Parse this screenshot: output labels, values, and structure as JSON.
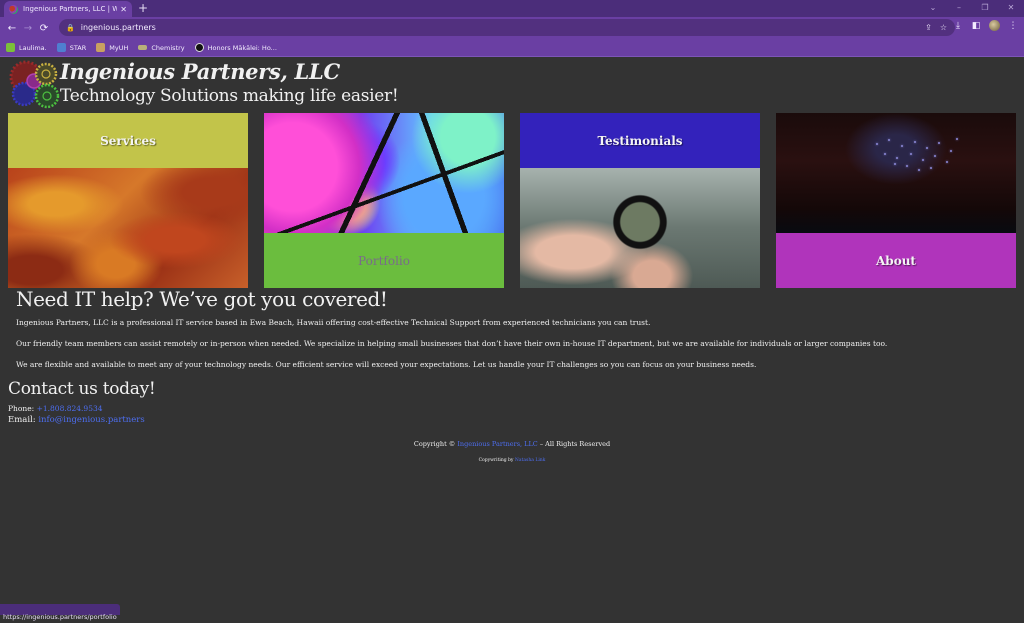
{
  "browser": {
    "tab": {
      "title": "Ingenious Partners, LLC | Welcome",
      "close": "✕"
    },
    "new_tab": "+",
    "window_controls": {
      "tab_search": "⌄",
      "minimize": "–",
      "restore": "❐",
      "close": "✕"
    },
    "nav": {
      "back": "←",
      "forward": "→",
      "reload": "⟳"
    },
    "address": {
      "lock_icon": "🔒",
      "url": "ingenious.partners"
    },
    "omnibox_icons": {
      "share": "⇪",
      "bookmark_star": "☆"
    },
    "toolbar_icons": {
      "download": "⤓",
      "side_panel": "◧",
      "menu": "⋮"
    },
    "bookmarks": [
      {
        "label": "Laulima.",
        "color": "#7bbf3a"
      },
      {
        "label": "STAR",
        "color": "#4f7fd0"
      },
      {
        "label": "MyUH",
        "color": "#c8a060"
      },
      {
        "label": "Chemistry",
        "color": "#b8b07a"
      },
      {
        "label": "Honors Mākālei: Ho...",
        "color": "#111111"
      }
    ],
    "status_url": "https://ingenious.partners/portfolio"
  },
  "site": {
    "name": "Ingenious Partners, LLC",
    "tagline": "Technology Solutions making life easier!",
    "tiles": [
      {
        "label": "Services",
        "color": "#c2c44a"
      },
      {
        "label": "Portfolio",
        "color": "#6bbd3e"
      },
      {
        "label": "Testimonials",
        "color": "#3322bb"
      },
      {
        "label": "About",
        "color": "#b034bb"
      }
    ],
    "intro": {
      "heading": "Need IT help? We’ve got you covered!",
      "paragraphs": [
        "Ingenious Partners, LLC is a professional IT service based in Ewa Beach, Hawaii offering cost-effective Technical Support from experienced technicians you can trust.",
        "Our friendly team members can assist remotely or in-person when needed. We specialize in helping small businesses that don’t have their own in-house IT department, but we are available for individuals or larger companies too.",
        "We are flexible and available to meet any of your technology needs. Our efficient service will exceed your expectations. Let us handle your IT challenges so you can focus on your business needs."
      ]
    },
    "contact": {
      "heading": "Contact us today!",
      "phone_label": "Phone:",
      "phone": "+1.808.824.9534",
      "email_label": "Email:",
      "email": "info@ingenious.partners"
    },
    "footer": {
      "copyright_prefix": "Copyright ©",
      "copyright_link": "Ingenious Partners, LLC",
      "copyright_suffix": "– All Rights Reserved",
      "credit_prefix": "Copywriting by",
      "credit_link": "Natasha Link"
    },
    "link_color": "#4d6ef0"
  }
}
